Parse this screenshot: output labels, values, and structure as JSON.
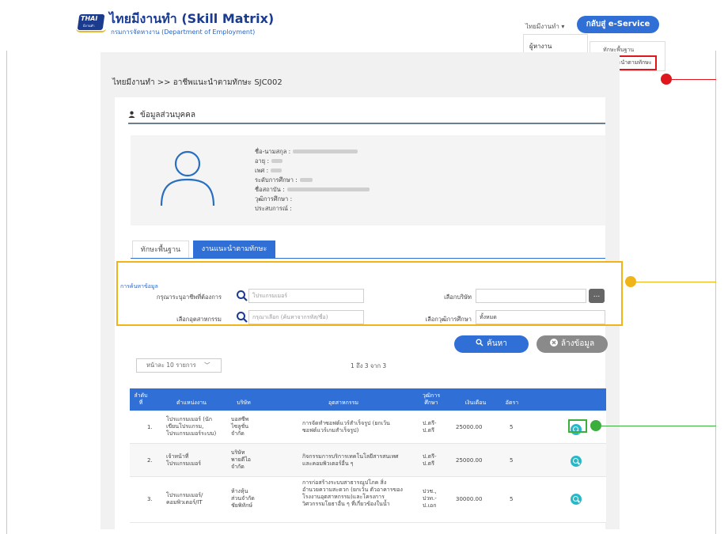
{
  "header": {
    "logo_text": "THAI",
    "logo_sub": "มีงานทำ",
    "title": "ไทยมีงานทำ (Skill Matrix)",
    "subtitle": "กรมการจัดหางาน (Department of Employment)",
    "nav_menu": "ไทยมีงานทำ ▾",
    "back_button": "กลับสู่ e-Service",
    "dropdown_item": "ผู้หางาน",
    "submenu": [
      "ทักษะพื้นฐาน",
      "อาชีพแนะนำตามทักษะ"
    ]
  },
  "breadcrumb": "ไทยมีงานทำ >> อาชีพแนะนำตามทักษะ SJC002",
  "personal": {
    "section_title": "ข้อมูลส่วนบุคคล",
    "fields": [
      {
        "label": "ชื่อ-นามสกุล :"
      },
      {
        "label": "อายุ :"
      },
      {
        "label": "เพศ :"
      },
      {
        "label": "ระดับการศึกษา :"
      },
      {
        "label": "ชื่อสถาบัน :"
      },
      {
        "label": "วุฒิการศึกษา :"
      },
      {
        "label": "ประสบการณ์ :"
      }
    ]
  },
  "tabs": [
    "ทักษะพื้นฐาน",
    "งานแนะนำตามทักษะ"
  ],
  "search": {
    "title": "การค้นหาข้อมูล",
    "occupation_label": "กรุณาระบุอาชีพที่ต้องการ",
    "occupation_value": "โปรแกรมเมอร์",
    "company_label": "เลือกบริษัท",
    "company_value": "",
    "industry_label": "เลือกอุตสาหกรรม",
    "industry_placeholder": "กรุณาเลือก (ค้นหาจากรหัส/ชื่อ)",
    "education_label": "เลือกวุฒิการศึกษา",
    "education_value": "ทั้งหมด",
    "more_button": "...",
    "search_button": "ค้นหา",
    "clear_button": "ล้างข้อมูล"
  },
  "pagination": {
    "per_page": "หน้าละ 10 รายการ",
    "info": "1 ถึง 3 จาก 3"
  },
  "table": {
    "headers": [
      "ลำดับ ที่",
      "ตำแหน่งงาน",
      "บริษัท",
      "อุตสาหกรรม",
      "วุฒิการ ศึกษา",
      "เงินเดือน",
      "อัตรา"
    ],
    "rows": [
      {
        "no": "1.",
        "position": "โปรแกรมเมอร์ (นัก\nเขียนโปรแกรม,\nโปรแกรมเมอร์ระบบ)",
        "company": "บอสซีพ\nไซลูชั่น\nจำกัด",
        "industry": "การจัดทำซอฟต์แวร์สำเร็จรูป (ยกเว้น\nซอฟต์แวร์เกมสำเร็จรูป)",
        "education": "ป.ตรี-\nป.ตรี",
        "salary": "25000.00",
        "rate": "5"
      },
      {
        "no": "2.",
        "position": "เจ้าหน้าที่\nโปรแกรมเมอร์",
        "company": "บริษัท\nพายดีไอ\nจำกัด",
        "industry": "กิจกรรมการบริการเทคโนโลยีสารสนเทศ\nและคอมพิวเตอร์อื่น ๆ",
        "education": "ป.ตรี-\nป.ตรี",
        "salary": "25000.00",
        "rate": "5"
      },
      {
        "no": "3.",
        "position": "โปรแกรมเมอร์/\nคอมพิวเตอร์/IT",
        "company": "ห้างหุ้น\nส่วนจำกัด\nชัยพิทักษ์",
        "industry": "การก่อสร้างระบบสาธารณูปโภค สิ่ง\nอำนวยความสะดวก (ยกเว้น ตัวอาคารของ\nโรงงานอุตสาหกรรม)และโครงการ\nวิศวกรรมโยธาอื่น ๆ ที่เกี่ยวข้องในน้ำ",
        "education": "ปวช.,\nปวท.-\nป.เอก",
        "salary": "30000.00",
        "rate": "5"
      }
    ]
  },
  "colors": {
    "primary": "#2f6fd6",
    "brand": "#1b3b8f",
    "annotation_red": "#e0161d",
    "annotation_yellow": "#f0b419",
    "annotation_green": "#3cae3c",
    "view_icon": "#28b8c8"
  }
}
